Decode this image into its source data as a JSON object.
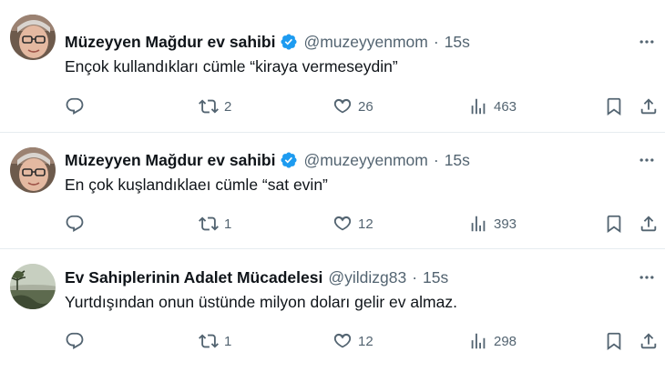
{
  "tweets": [
    {
      "name": "Müzeyyen Mağdur ev sahibi",
      "verified": true,
      "handle": "@muzeyyenmom",
      "separator": "·",
      "time": "15s",
      "text": "Ençok kullandıkları cümle “kiraya vermeseydin”",
      "replies": "",
      "retweets": "2",
      "likes": "26",
      "views": "463",
      "avatar": "avatar-woman-glasses"
    },
    {
      "name": "Müzeyyen Mağdur ev sahibi",
      "verified": true,
      "handle": "@muzeyyenmom",
      "separator": "·",
      "time": "15s",
      "text": "En çok kuşlandıklaeı cümle “sat evin”",
      "replies": "",
      "retweets": "1",
      "likes": "12",
      "views": "393",
      "avatar": "avatar-woman-glasses"
    },
    {
      "name": "Ev Sahiplerinin Adalet Mücadelesi",
      "verified": false,
      "handle": "@yildizg83",
      "separator": "·",
      "time": "15s",
      "text": "Yurtdışından onun üstünde milyon doları gelir ev almaz.",
      "replies": "",
      "retweets": "1",
      "likes": "12",
      "views": "298",
      "avatar": "avatar-landscape"
    }
  ],
  "colors": {
    "verified": "#1d9bf0",
    "secondary_text": "#536471",
    "primary_text": "#0f1419",
    "divider": "#e6ecf0"
  }
}
